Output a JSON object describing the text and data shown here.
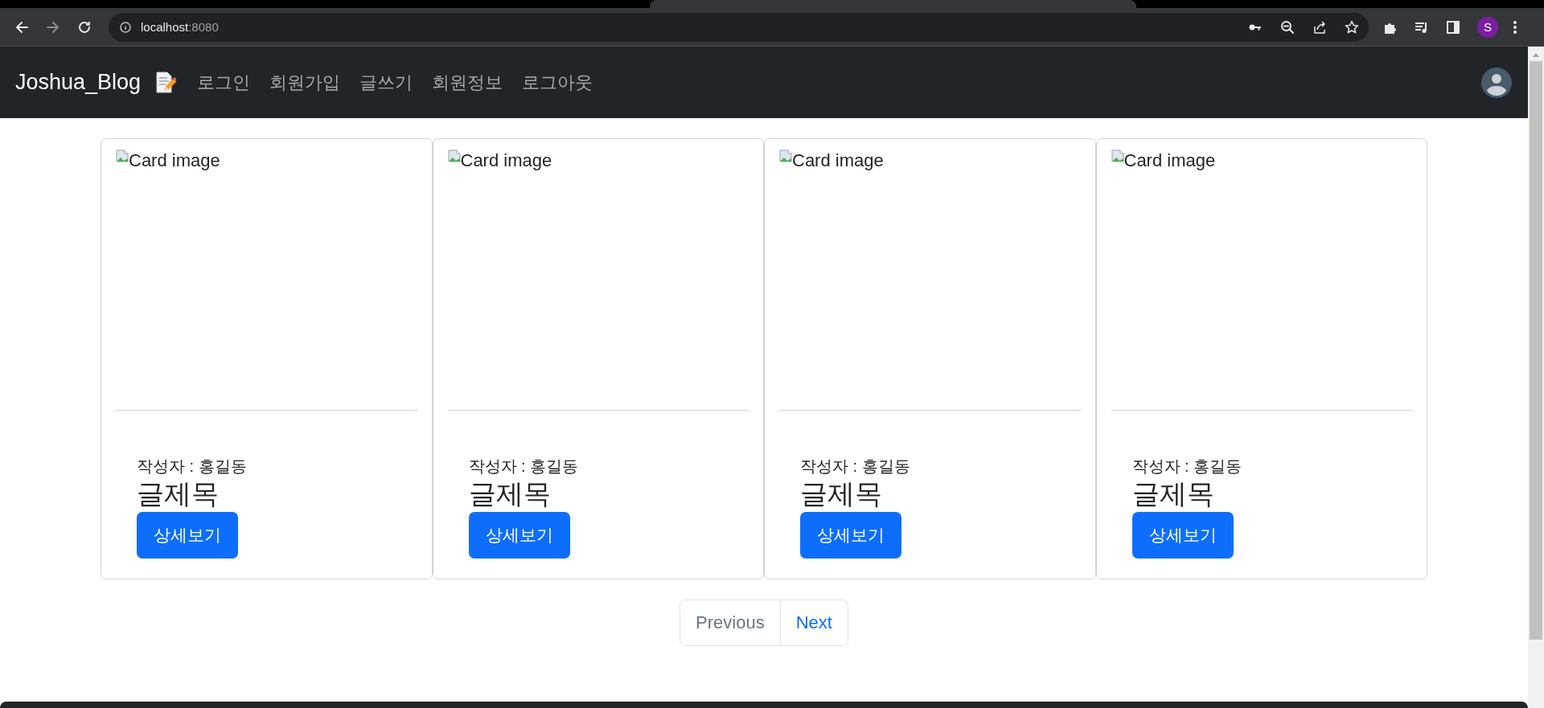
{
  "browser": {
    "url": "localhost",
    "port": ":8080",
    "profile_initial": "S"
  },
  "navbar": {
    "brand": "Joshua_Blog",
    "links": [
      {
        "label": "로그인"
      },
      {
        "label": "회원가입"
      },
      {
        "label": "글쓰기"
      },
      {
        "label": "회원정보"
      },
      {
        "label": "로그아웃"
      }
    ]
  },
  "cards": [
    {
      "image_alt": "Card image",
      "author": "작성자 : 홍길동",
      "title": "글제목",
      "button": "상세보기"
    },
    {
      "image_alt": "Card image",
      "author": "작성자 : 홍길동",
      "title": "글제목",
      "button": "상세보기"
    },
    {
      "image_alt": "Card image",
      "author": "작성자 : 홍길동",
      "title": "글제목",
      "button": "상세보기"
    },
    {
      "image_alt": "Card image",
      "author": "작성자 : 홍길동",
      "title": "글제목",
      "button": "상세보기"
    }
  ],
  "pagination": [
    {
      "label": "Previous",
      "disabled": true
    },
    {
      "label": "Next",
      "disabled": false
    }
  ]
}
